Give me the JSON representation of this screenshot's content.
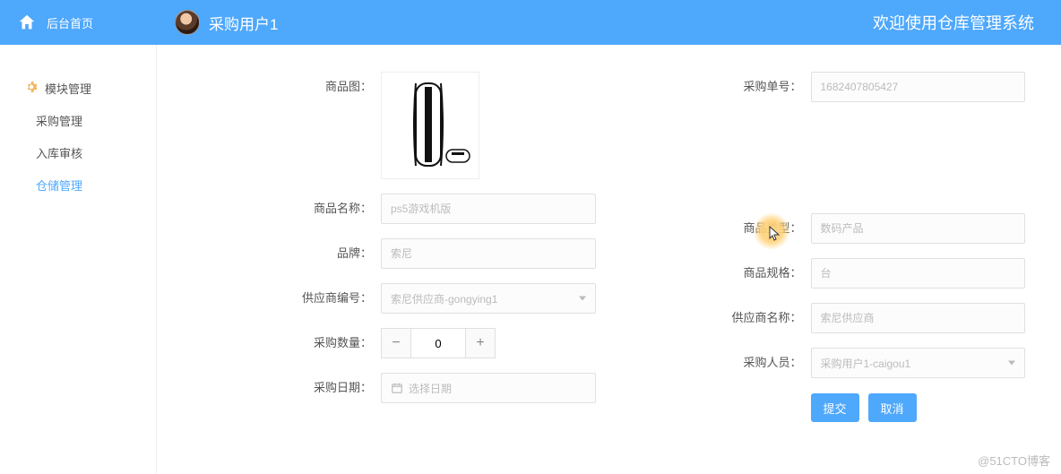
{
  "header": {
    "home_label": "后台首页",
    "user_name": "采购用户1",
    "welcome": "欢迎使用仓库管理系统"
  },
  "sidebar": {
    "items": [
      {
        "label": "模块管理",
        "icon": "gear-icon",
        "active": false
      },
      {
        "label": "采购管理",
        "active": false
      },
      {
        "label": "入库审核",
        "active": false
      },
      {
        "label": "仓储管理",
        "active": true
      }
    ]
  },
  "form": {
    "left": {
      "product_image_label": "商品图",
      "product_name_label": "商品名称",
      "product_name_placeholder": "ps5游戏机版",
      "brand_label": "品牌",
      "brand_placeholder": "索尼",
      "supplier_code_label": "供应商编号",
      "supplier_code_value": "索尼供应商-gongying1",
      "qty_label": "采购数量",
      "qty_value": "0",
      "date_label": "采购日期",
      "date_placeholder": "选择日期"
    },
    "right": {
      "order_no_label": "采购单号",
      "order_no_placeholder": "1682407805427",
      "product_type_label": "商品类型",
      "product_type_placeholder": "数码产品",
      "spec_label": "商品规格",
      "spec_placeholder": "台",
      "supplier_name_label": "供应商名称",
      "supplier_name_placeholder": "索尼供应商",
      "buyer_label": "采购人员",
      "buyer_value": "采购用户1-caigou1",
      "submit_label": "提交",
      "cancel_label": "取消"
    }
  },
  "watermark": "@51CTO博客"
}
